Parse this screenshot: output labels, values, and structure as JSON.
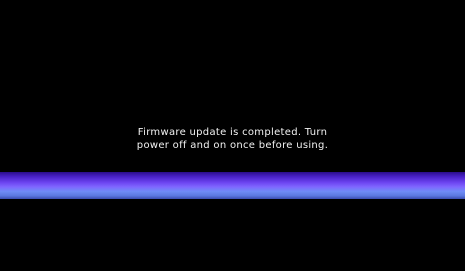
{
  "screen": {
    "message": {
      "line1": "Firmware update is completed. Turn",
      "line2": "power off and on once before using."
    },
    "progress": {
      "fraction": 1.0
    }
  },
  "colors": {
    "background": "#000000",
    "text": "#f2f2f2",
    "bar_primary": "#7f66ff",
    "bar_secondary": "#5b78e0"
  }
}
